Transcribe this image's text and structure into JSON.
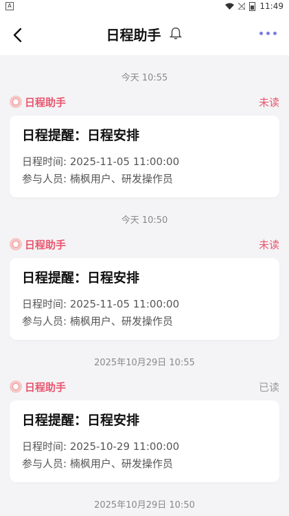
{
  "status_bar": {
    "left_icon": "A",
    "time": "11:49",
    "icons": [
      "wifi-icon",
      "signal-icon",
      "battery-icon"
    ]
  },
  "header": {
    "title": "日程助手",
    "bell_icon": "bell-icon",
    "more_icon": "more-dots-icon"
  },
  "colors": {
    "accent_red": "#e8556e",
    "more_dots": "#7b7be6",
    "background": "#f4f4f6"
  },
  "messages": [
    {
      "time": "今天 10:55",
      "sender": "日程助手",
      "status": "未读",
      "title": "日程提醒：日程安排",
      "time_line": "日程时间: 2025-11-05 11:00:00",
      "participants": "参与人员: 楠枫用户、研发操作员"
    },
    {
      "time": "今天 10:50",
      "sender": "日程助手",
      "status": "未读",
      "title": "日程提醒：日程安排",
      "time_line": "日程时间: 2025-11-05 11:00:00",
      "participants": "参与人员: 楠枫用户、研发操作员"
    },
    {
      "time": "2025年10月29日 10:55",
      "sender": "日程助手",
      "status": "已读",
      "title": "日程提醒：日程安排",
      "time_line": "日程时间: 2025-10-29 11:00:00",
      "participants": "参与人员: 楠枫用户、研发操作员"
    },
    {
      "time": "2025年10月29日 10:50"
    }
  ]
}
